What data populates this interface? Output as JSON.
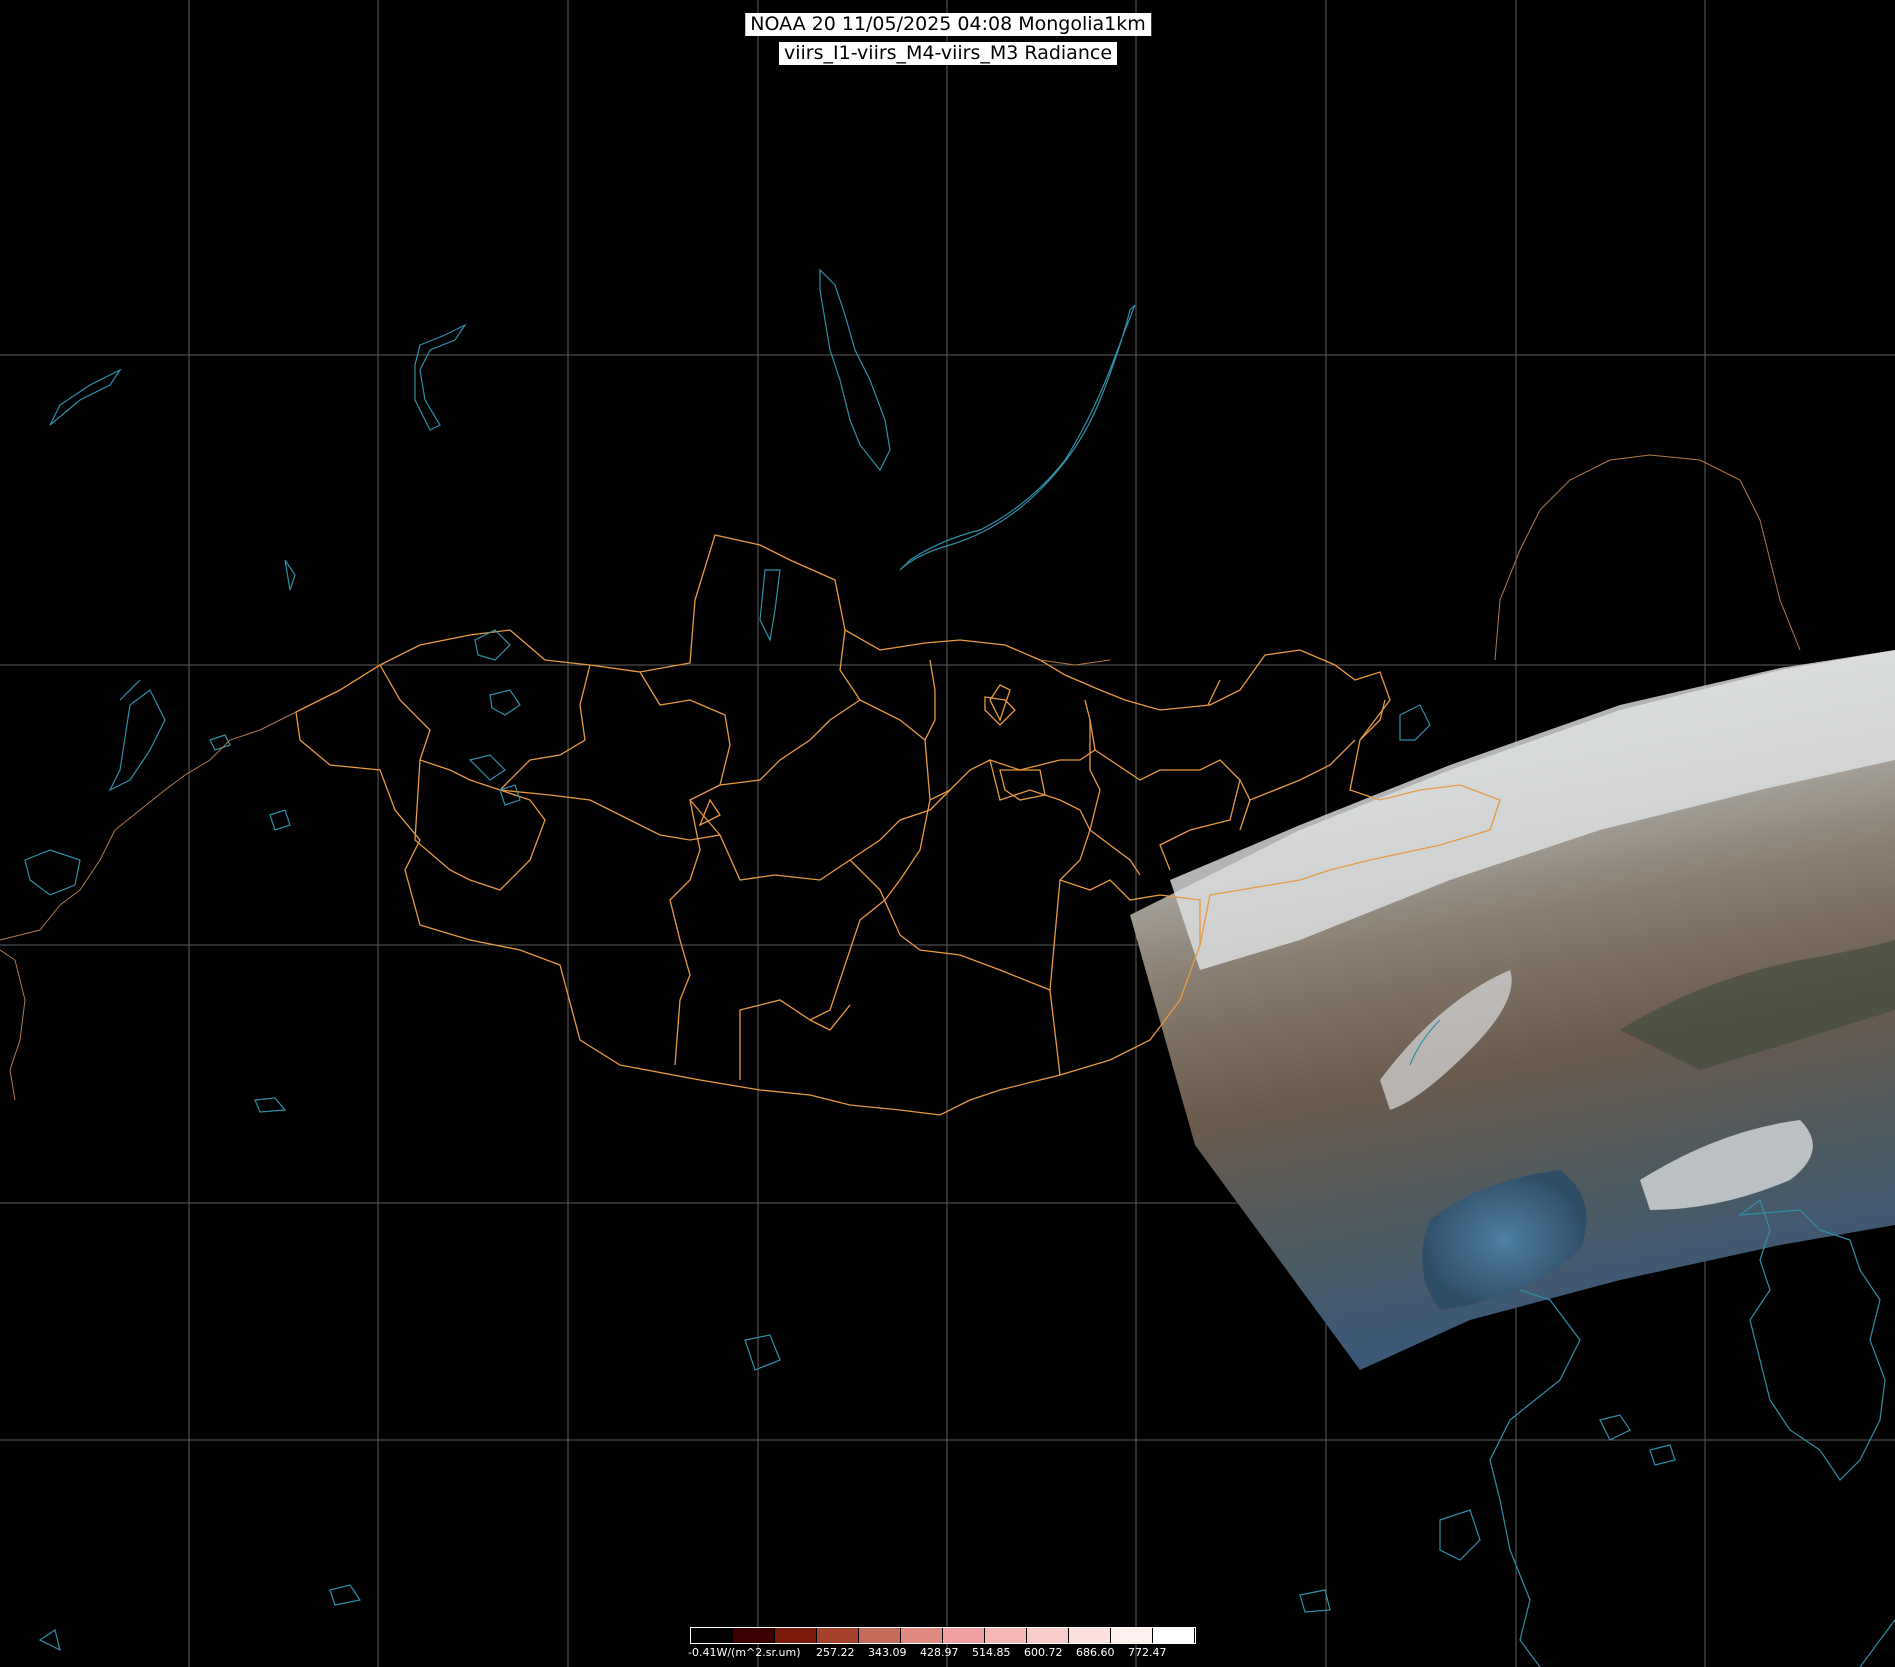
{
  "title": {
    "line1": "NOAA 20 11/05/2025 04:08 Mongolia1km",
    "line2": "viirs_I1-viirs_M4-viirs_M3 Radiance"
  },
  "legend": {
    "min_label": "-0.41W/(m^2.sr.um)",
    "ticks": [
      "257.22",
      "343.09",
      "428.97",
      "514.85",
      "600.72",
      "686.60",
      "772.47"
    ],
    "swatch_colors": [
      "#000000",
      "#3a0000",
      "#7a1a0a",
      "#a5402a",
      "#c66a5a",
      "#e08a80",
      "#f0a0a0",
      "#f6b8b4",
      "#f9ccca",
      "#fce0dd",
      "#fef0ee",
      "#ffffff"
    ]
  },
  "colors": {
    "background": "#000000",
    "graticule": "#6e6e6e",
    "coast": "#2f8fa8",
    "borders": "#e79a42"
  }
}
